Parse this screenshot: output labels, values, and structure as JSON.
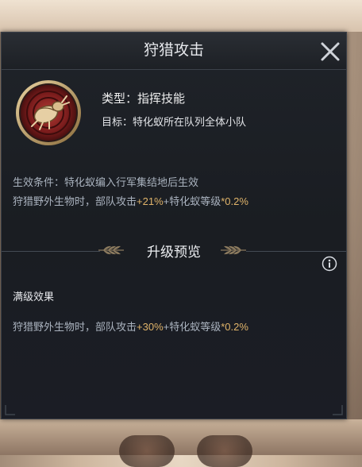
{
  "dialog": {
    "title": "狩猎攻击",
    "close_icon": "close-icon"
  },
  "skill": {
    "icon": "beetle-skill-icon",
    "type_label": "类型：指挥技能",
    "target_label": "目标：特化蚁所在队列全体小队"
  },
  "current": {
    "condition": "生效条件：特化蚁编入行军集结地后生效",
    "effect_prefix": "狩猎野外生物时，部队攻击",
    "effect_bonus": "+21%",
    "effect_mid": "+特化蚁等级",
    "effect_scale": "*0.2%"
  },
  "preview": {
    "title": "升级预览",
    "info_icon": "info-icon",
    "max_label": "满级效果",
    "effect_prefix": "狩猎野外生物时，部队攻击",
    "effect_bonus": "+30%",
    "effect_mid": "+特化蚁等级",
    "effect_scale": "*0.2%"
  },
  "colors": {
    "highlight": "#e0b46a",
    "panel_bg": "#1f2329",
    "text_muted": "#aab3bf"
  }
}
